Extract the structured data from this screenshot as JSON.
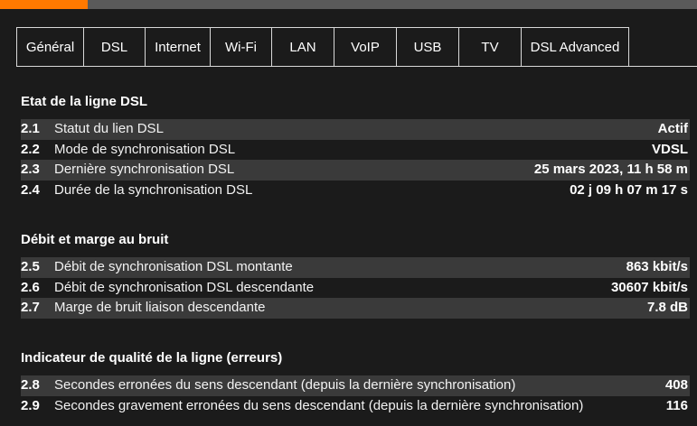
{
  "brand": {
    "accent_color": "#ff7900",
    "topbar_color": "#5a5a5a",
    "background": "#1b1b1b",
    "row_alt": "#3a3a3a"
  },
  "tabs": [
    {
      "label": "Général"
    },
    {
      "label": "DSL",
      "active": true
    },
    {
      "label": "Internet"
    },
    {
      "label": "Wi-Fi"
    },
    {
      "label": "LAN"
    },
    {
      "label": "VoIP"
    },
    {
      "label": "USB"
    },
    {
      "label": "TV"
    },
    {
      "label": "DSL Advanced"
    }
  ],
  "sections": [
    {
      "title": "Etat de la ligne DSL",
      "rows": [
        {
          "num": "2.1",
          "label": "Statut du lien DSL",
          "value": "Actif"
        },
        {
          "num": "2.2",
          "label": "Mode de synchronisation DSL",
          "value": "VDSL"
        },
        {
          "num": "2.3",
          "label": "Dernière synchronisation DSL",
          "value": "25 mars 2023, 11 h 58 m"
        },
        {
          "num": "2.4",
          "label": "Durée de la synchronisation DSL",
          "value": "02 j 09 h 07 m 17 s"
        }
      ]
    },
    {
      "title": "Débit et marge au bruit",
      "rows": [
        {
          "num": "2.5",
          "label": "Débit de synchronisation DSL montante",
          "value": "863 kbit/s"
        },
        {
          "num": "2.6",
          "label": "Débit de synchronisation DSL descendante",
          "value": "30607 kbit/s"
        },
        {
          "num": "2.7",
          "label": "Marge de bruit liaison descendante",
          "value": "7.8 dB"
        }
      ]
    },
    {
      "title": "Indicateur de qualité de la ligne (erreurs)",
      "rows": [
        {
          "num": "2.8",
          "label": "Secondes erronées du sens descendant (depuis la dernière synchronisation)",
          "value": "408"
        },
        {
          "num": "2.9",
          "label": "Secondes gravement erronées du sens descendant (depuis la dernière synchronisation)",
          "value": "116"
        }
      ]
    }
  ]
}
